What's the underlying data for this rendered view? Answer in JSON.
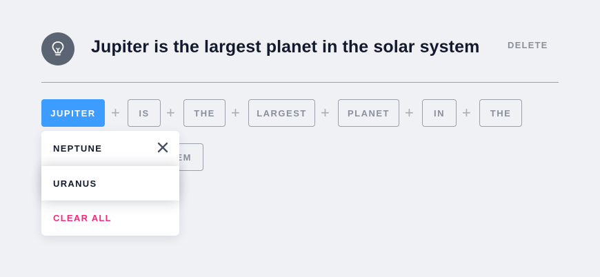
{
  "card": {
    "title": "Jupiter is the largest planet in the solar system",
    "delete_label": "DELETE",
    "icon": "lightbulb-icon"
  },
  "words": {
    "row1": [
      "JUPITER",
      "IS",
      "THE",
      "LARGEST",
      "PLANET",
      "IN",
      "THE"
    ],
    "row2_partial": "EM"
  },
  "plus_symbol": "+",
  "dropdown": {
    "items": [
      "NEPTUNE",
      "URANUS"
    ],
    "clear_label": "CLEAR ALL",
    "close_icon": "close-icon"
  },
  "colors": {
    "accent": "#3d9cff",
    "clear": "#ee2c7b",
    "icon_bg": "#5b6472"
  }
}
